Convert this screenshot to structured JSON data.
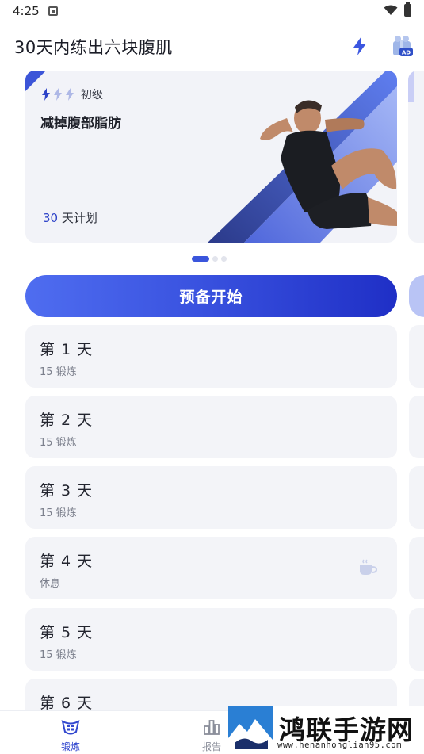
{
  "status_bar": {
    "time": "4:25"
  },
  "app_bar": {
    "title": "30天内练出六块腹肌"
  },
  "plan_card": {
    "level_label": "初级",
    "title": "减掉腹部脂肪",
    "days_number": "30",
    "days_suffix": " 天计划"
  },
  "carousel": {
    "page_count": 3,
    "active_index": 0
  },
  "start_button": {
    "label": "预备开始"
  },
  "days": [
    {
      "title": "第 1 天",
      "subtitle": "15 锻炼"
    },
    {
      "title": "第 2 天",
      "subtitle": "15 锻炼"
    },
    {
      "title": "第 3 天",
      "subtitle": "15 锻炼"
    },
    {
      "title": "第 4 天",
      "subtitle": "休息",
      "icon": "coffee-cup-icon"
    },
    {
      "title": "第 5 天",
      "subtitle": "15 锻炼"
    },
    {
      "title": "第 6 天",
      "subtitle": ""
    }
  ],
  "bottom_nav": {
    "items": [
      {
        "label": "锻炼",
        "icon": "abs-icon",
        "active": true
      },
      {
        "label": "报告",
        "icon": "bar-chart-icon",
        "active": false
      }
    ]
  },
  "watermark": {
    "title": "鸿联手游网",
    "url": "www.henanhonglian95.com"
  },
  "colors": {
    "accent": "#3a53e0",
    "card_bg": "#f3f4f8",
    "active_nav": "#3147cf"
  }
}
